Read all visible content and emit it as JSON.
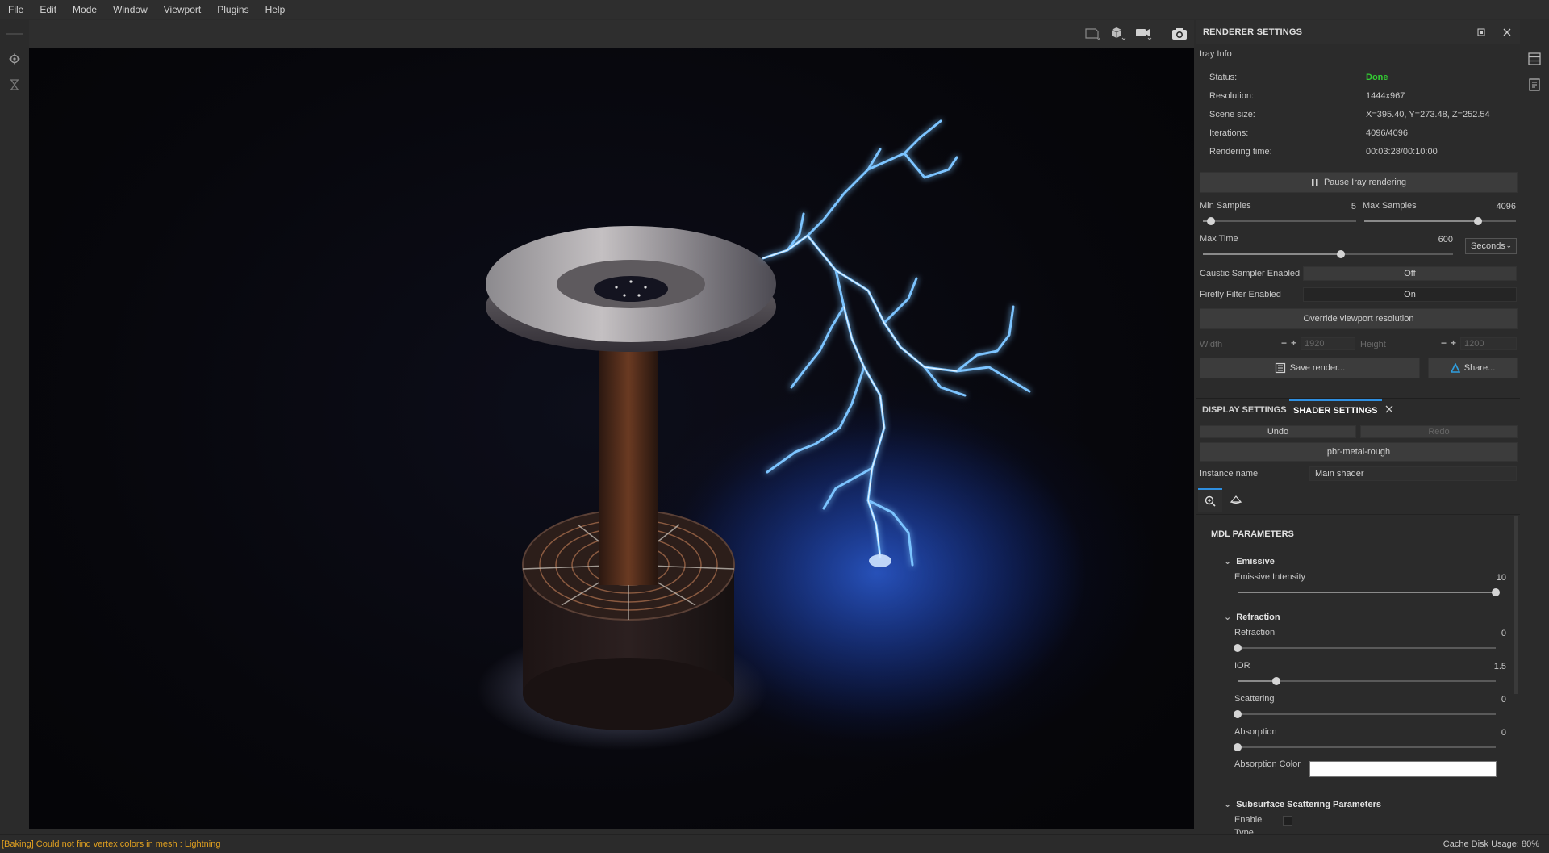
{
  "menu": [
    "File",
    "Edit",
    "Mode",
    "Window",
    "Viewport",
    "Plugins",
    "Help"
  ],
  "viewport": {
    "toolbar_icons": [
      "frame-icon",
      "cube-icon",
      "camera-icon",
      "screenshot-icon"
    ],
    "render_resolution": "1444x967"
  },
  "renderer": {
    "title": "RENDERER SETTINGS",
    "info_section": "Iray Info",
    "info": [
      {
        "label": "Status:",
        "value": "Done"
      },
      {
        "label": "Resolution:",
        "value": "1444x967"
      },
      {
        "label": "Scene size:",
        "value": "X=395.40, Y=273.48, Z=252.54"
      },
      {
        "label": "Iterations:",
        "value": "4096/4096"
      },
      {
        "label": "Rendering time:",
        "value": "00:03:28/00:10:00"
      }
    ],
    "status_color": "#33cc33",
    "pause_button": "Pause Iray rendering",
    "min_samples": {
      "label": "Min Samples",
      "value": "5",
      "fraction": 0.05
    },
    "max_samples": {
      "label": "Max Samples",
      "value": "4096",
      "fraction": 0.75
    },
    "max_time": {
      "label": "Max Time",
      "value": "600",
      "fraction": 0.55
    },
    "time_unit": "Seconds",
    "caustic": {
      "label": "Caustic Sampler Enabled",
      "value": "Off"
    },
    "firefly": {
      "label": "Firefly Filter Enabled",
      "value": "On"
    },
    "override_button": "Override viewport resolution",
    "width": {
      "label": "Width",
      "value": "1920"
    },
    "height": {
      "label": "Height",
      "value": "1200"
    },
    "save_button": "Save render...",
    "share_button": "Share..."
  },
  "tabs": [
    "DISPLAY SETTINGS",
    "SHADER SETTINGS"
  ],
  "shader": {
    "undo": "Undo",
    "redo": "Redo",
    "material": "pbr-metal-rough",
    "instance_label": "Instance name",
    "instance_value": "Main shader",
    "section_title": "MDL PARAMETERS",
    "groups": {
      "emissive": {
        "title": "Emissive",
        "params": [
          {
            "label": "Emissive Intensity",
            "value": "10",
            "fraction": 1.0
          }
        ]
      },
      "refraction": {
        "title": "Refraction",
        "params": [
          {
            "label": "Refraction",
            "value": "0",
            "fraction": 0.0
          },
          {
            "label": "IOR",
            "value": "1.5",
            "fraction": 0.15
          },
          {
            "label": "Scattering",
            "value": "0",
            "fraction": 0.0
          },
          {
            "label": "Absorption",
            "value": "0",
            "fraction": 0.0
          }
        ],
        "absorption_color_label": "Absorption Color",
        "absorption_color": "#ffffff"
      },
      "subsurface": {
        "title": "Subsurface Scattering Parameters",
        "enable_label": "Enable",
        "type_label": "Type"
      }
    }
  },
  "status_message": "[Baking] Could not find vertex colors in mesh : Lightning",
  "cache_usage": "Cache Disk Usage:   80%"
}
